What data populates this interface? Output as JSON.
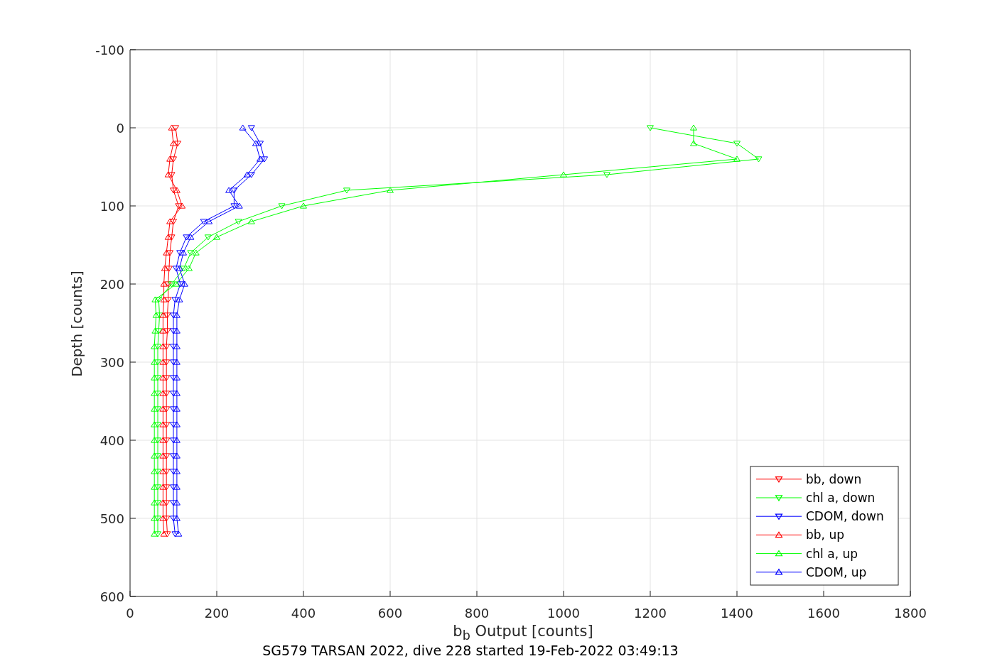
{
  "figure": {
    "caption": "SG579 TARSAN 2022, dive 228 started 19-Feb-2022 03:49:13",
    "chart_data": {
      "type": "line",
      "orientation": "horizontal",
      "xlabel": "b$_{b}$ Output [counts]",
      "ylabel": "Depth [counts]",
      "xlim": [
        0,
        1800
      ],
      "ylim": [
        600,
        -100
      ],
      "grid": true,
      "legend": true,
      "xticks": [
        0,
        200,
        400,
        600,
        800,
        1000,
        1200,
        1400,
        1600,
        1800
      ],
      "yticks": [
        -100,
        0,
        100,
        200,
        300,
        400,
        500,
        600
      ],
      "x": [
        0,
        20,
        40,
        60,
        80,
        100,
        120,
        140,
        160,
        180,
        200,
        220,
        240,
        260,
        280,
        300,
        320,
        340,
        360,
        380,
        400,
        420,
        440,
        460,
        480,
        500,
        520
      ],
      "series": [
        {
          "name": "bb, down",
          "color": "#ff0000",
          "marker": "triangle",
          "values": [
            105,
            110,
            100,
            96,
            100,
            112,
            100,
            96,
            92,
            90,
            88,
            88,
            86,
            86,
            84,
            84,
            84,
            84,
            84,
            84,
            84,
            84,
            84,
            84,
            84,
            84,
            86
          ]
        },
        {
          "name": "chl a, down",
          "color": "#00ff00",
          "marker": "triangle",
          "values": [
            1200,
            1400,
            1450,
            1100,
            500,
            350,
            250,
            180,
            140,
            124,
            96,
            66,
            68,
            66,
            64,
            64,
            64,
            64,
            64,
            64,
            64,
            64,
            64,
            64,
            64,
            64,
            64
          ]
        },
        {
          "name": "CDOM, down",
          "color": "#0000ff",
          "marker": "triangle",
          "values": [
            280,
            300,
            310,
            280,
            240,
            240,
            170,
            130,
            115,
            106,
            116,
            104,
            100,
            100,
            100,
            100,
            100,
            100,
            100,
            100,
            100,
            100,
            100,
            100,
            100,
            100,
            104
          ]
        },
        {
          "name": "bb, up",
          "color": "#ff0000",
          "marker": "triangle",
          "values": [
            96,
            100,
            92,
            88,
            108,
            120,
            92,
            88,
            84,
            80,
            78,
            78,
            76,
            76,
            76,
            76,
            76,
            76,
            76,
            76,
            76,
            76,
            76,
            76,
            76,
            76,
            78
          ]
        },
        {
          "name": "chl a, up",
          "color": "#00ff00",
          "marker": "triangle",
          "values": [
            1300,
            1300,
            1400,
            1000,
            600,
            400,
            280,
            200,
            152,
            136,
            106,
            58,
            60,
            58,
            56,
            56,
            56,
            56,
            56,
            56,
            56,
            56,
            56,
            56,
            56,
            56,
            56
          ]
        },
        {
          "name": "CDOM, up",
          "color": "#0000ff",
          "marker": "triangle",
          "values": [
            260,
            290,
            300,
            270,
            228,
            252,
            182,
            140,
            123,
            114,
            126,
            114,
            108,
            108,
            108,
            108,
            108,
            108,
            108,
            108,
            108,
            108,
            108,
            108,
            108,
            108,
            112
          ]
        }
      ]
    }
  }
}
